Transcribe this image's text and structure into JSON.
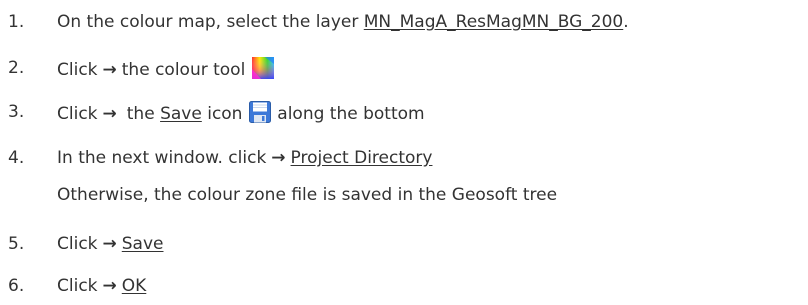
{
  "steps": [
    {
      "number": "1.",
      "before": "On the colour map, select the layer ",
      "link": "MN_MagA_ResMagMN_BG_200",
      "after": "."
    },
    {
      "number": "2.",
      "before": "Click",
      "arrow": "→",
      "after": "the colour tool",
      "icon": "colour-tool-icon"
    },
    {
      "number": "3.",
      "before": "Click",
      "arrow": "→",
      "mid": "the ",
      "link": "Save",
      "mid2": " icon",
      "icon": "save-icon",
      "after": "along the bottom"
    },
    {
      "number": "4.",
      "before": "In the next window. click",
      "arrow": "→",
      "link": "Project Directory"
    },
    {
      "note": "Otherwise, the colour zone file is saved in the Geosoft tree"
    },
    {
      "number": "5.",
      "before": "Click",
      "arrow": "→",
      "link": "Save"
    },
    {
      "number": "6.",
      "before": "Click",
      "arrow": "→",
      "link": "OK"
    }
  ],
  "colors": {
    "text": "#333333",
    "save_icon_blue": "#3c78d8"
  }
}
